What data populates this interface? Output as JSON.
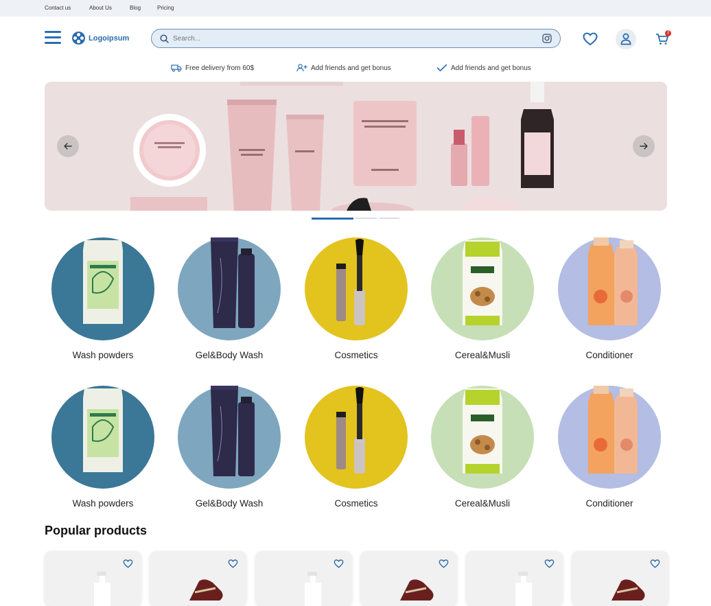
{
  "topbar": {
    "links": [
      "Contact us",
      "About Us",
      "Blog",
      "Pricing"
    ]
  },
  "header": {
    "logo": "Logoipsum",
    "search_placeholder": "Search...",
    "cart_count": "2"
  },
  "perks": [
    {
      "icon": "truck-icon",
      "text": "Free delivery from 60$"
    },
    {
      "icon": "add-user-icon",
      "text": "Add friends and get bonus"
    },
    {
      "icon": "check-icon",
      "text": "Add friends and get bonus"
    }
  ],
  "banner": {
    "slides": 3,
    "active_slide": 1
  },
  "categories_row1": [
    {
      "label": "Wash powders",
      "color": "#3b7797",
      "icon": "bag-product"
    },
    {
      "label": "Gel&Body Wash",
      "color": "#7ea6bf",
      "icon": "tube-product"
    },
    {
      "label": "Cosmetics",
      "color": "#e3c31d",
      "icon": "mascara-product"
    },
    {
      "label": "Cereal&Musli",
      "color": "#c6dfb6",
      "icon": "cereal-product"
    },
    {
      "label": "Conditioner",
      "color": "#b4bde3",
      "icon": "bottle-product"
    }
  ],
  "categories_row2": [
    {
      "label": "Wash powders",
      "color": "#3b7797",
      "icon": "bag-product"
    },
    {
      "label": "Gel&Body Wash",
      "color": "#7ea6bf",
      "icon": "tube-product"
    },
    {
      "label": "Cosmetics",
      "color": "#e3c31d",
      "icon": "mascara-product"
    },
    {
      "label": "Cereal&Musli",
      "color": "#c6dfb6",
      "icon": "cereal-product"
    },
    {
      "label": "Conditioner",
      "color": "#b4bde3",
      "icon": "bottle-product"
    }
  ],
  "popular": {
    "title": "Popular products",
    "products": [
      {
        "kind": "pump-bottle"
      },
      {
        "kind": "shoe"
      },
      {
        "kind": "pump-bottle"
      },
      {
        "kind": "shoe"
      },
      {
        "kind": "pump-bottle"
      },
      {
        "kind": "shoe"
      }
    ]
  },
  "colors": {
    "accent": "#2b6cb0",
    "badge": "#d6322d",
    "topbar_bg": "#eef1f5"
  }
}
